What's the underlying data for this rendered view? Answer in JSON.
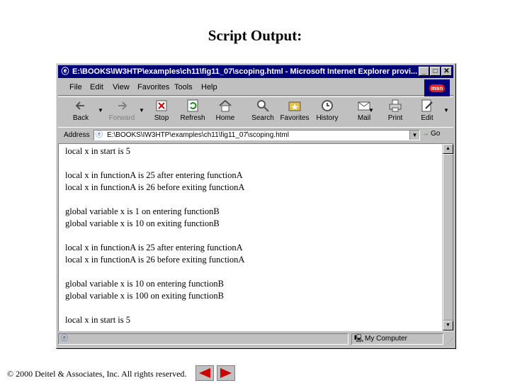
{
  "slide": {
    "title": "Script Output:",
    "copyright_symbol": "©",
    "copyright": "2000 Deitel & Associates, Inc.  All rights reserved."
  },
  "window": {
    "title": "E:\\BOOKS\\IW3HTP\\examples\\ch11\\fig11_07\\scoping.html - Microsoft Internet Explorer provi...",
    "minimize": "_",
    "maximize": "□",
    "close": "✕"
  },
  "menu": [
    "File",
    "Edit",
    "View",
    "Favorites",
    "Tools",
    "Help"
  ],
  "toolbar": {
    "back": "Back",
    "forward": "Forward",
    "stop": "Stop",
    "refresh": "Refresh",
    "home": "Home",
    "search": "Search",
    "favorites": "Favorites",
    "history": "History",
    "mail": "Mail",
    "print": "Print",
    "edit": "Edit"
  },
  "address": {
    "label": "Address",
    "value": "E:\\BOOKS\\IW3HTP\\examples\\ch11\\fig11_07\\scoping.html",
    "go": "Go"
  },
  "content": {
    "lines": [
      "local x in start is 5",
      "",
      "local x in functionA is 25 after entering functionA",
      "local x in functionA is 26 before exiting functionA",
      "",
      "global variable x is 1 on entering functionB",
      "global variable x is 10 on exiting functionB",
      "",
      "local x in functionA is 25 after entering functionA",
      "local x in functionA is 26 before exiting functionA",
      "",
      "global variable x is 10 on entering functionB",
      "global variable x is 100 on exiting functionB",
      "",
      "local x in start is 5"
    ]
  },
  "status": {
    "zone": "My Computer"
  },
  "icons": {
    "ie_page": "ie-page-icon",
    "msn": "msn",
    "back": "back-arrow-icon",
    "forward": "forward-arrow-icon",
    "stop": "stop-icon",
    "refresh": "refresh-icon",
    "home": "home-icon",
    "search": "search-icon",
    "favorites": "favorites-icon",
    "history": "history-icon",
    "mail": "mail-icon",
    "print": "print-icon",
    "edit": "edit-icon",
    "computer": "computer-icon",
    "prev_slide": "prev-slide-icon",
    "next_slide": "next-slide-icon"
  },
  "colors": {
    "titlebar": "#00007b",
    "chrome": "#c0c0c0",
    "nav_arrow": "#cc0000"
  }
}
